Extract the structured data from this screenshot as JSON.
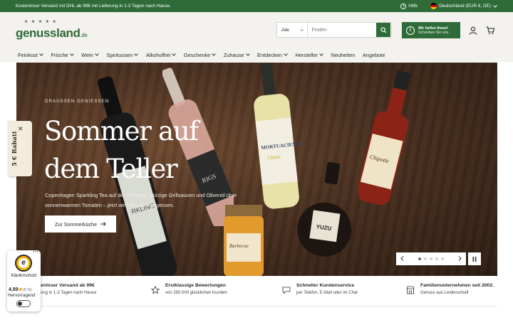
{
  "topbar": {
    "promo": "Kostenloser Versand mit DHL ab 99€ mit Lieferung in 1-3 Tagen nach Hause.",
    "help": "Hilfe",
    "country": "Deutschland (EUR €, DE)"
  },
  "header": {
    "logo_text": "genussland",
    "logo_tld": ".de",
    "search_category": "Alle",
    "search_placeholder": "Finden",
    "help_title": "Wir helfen Ihnen!",
    "help_subtitle": "Schreiben Sie uns."
  },
  "nav": [
    {
      "label": "Feinkost",
      "has_menu": true
    },
    {
      "label": "Frische",
      "has_menu": true
    },
    {
      "label": "Wein",
      "has_menu": true
    },
    {
      "label": "Spirituosen",
      "has_menu": true
    },
    {
      "label": "Alkoholfrei",
      "has_menu": true
    },
    {
      "label": "Geschenke",
      "has_menu": true
    },
    {
      "label": "Zuhause",
      "has_menu": true
    },
    {
      "label": "Entdecken",
      "has_menu": true
    },
    {
      "label": "Hersteller",
      "has_menu": true
    },
    {
      "label": "Neuheiten",
      "has_menu": false
    },
    {
      "label": "Angebote",
      "has_menu": false
    }
  ],
  "hero": {
    "kicker": "DRAUSSEN GENIESSEN",
    "title": "Sommer auf dem Teller",
    "description": "Copenhagen Sparkling Tea auf der Terrasse, würzige Grillsaucen und Olivenöl über sonnenwarmen Tomaten – jetzt wird draußen gegessen.",
    "cta": "Zur Sommerküche",
    "slides": 5,
    "active_slide": 1
  },
  "rabatt": {
    "label": "5 € Rabatt"
  },
  "usps": [
    {
      "title": "Kostenloser Versand ab 99€",
      "subtitle": "Lieferung in 1-3 Tagen nach Hause",
      "icon": "truck-icon"
    },
    {
      "title": "Erstklassige Bewertungen",
      "subtitle": "von 250.000 glücklichen Kunden",
      "icon": "star-icon"
    },
    {
      "title": "Schneller Kundenservice",
      "subtitle": "per Telefon, E-Mail oder im Chat",
      "icon": "chat-icon"
    },
    {
      "title": "Familienunternehmen seit 2002.",
      "subtitle": "Genuss aus Leidenschaft",
      "icon": "store-icon"
    }
  ],
  "trusted": {
    "label": "Käuferschutz",
    "score": "4,89",
    "count": "(8.7k)",
    "verdict": "Hervorragend"
  },
  "colors": {
    "brand": "#2e6b38",
    "header_bg": "#f3f2ee",
    "hero_bg": "#4a3020"
  }
}
